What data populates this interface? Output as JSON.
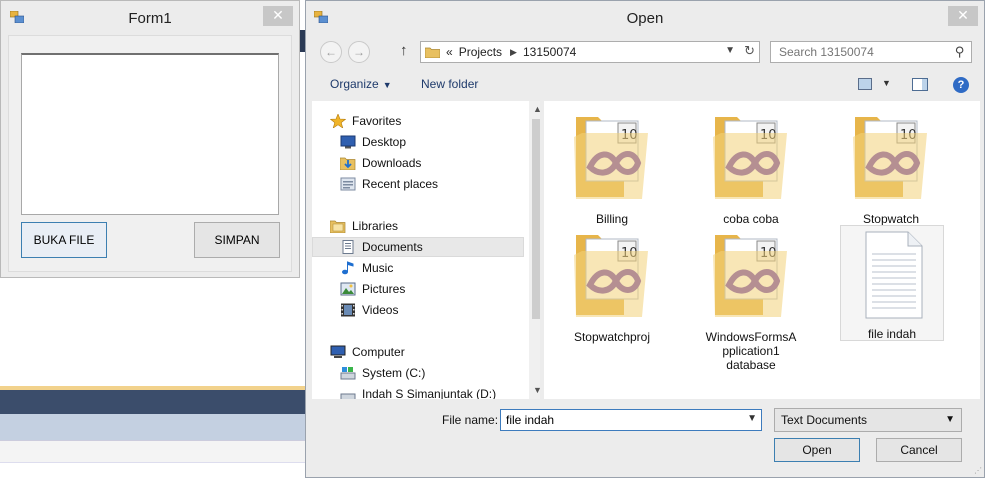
{
  "form1": {
    "title": "Form1",
    "close": "✕",
    "buka_label": "BUKA FILE",
    "simpan_label": "SIMPAN"
  },
  "dialog": {
    "title": "Open",
    "close": "✕",
    "nav": {
      "back": "←",
      "forward": "→",
      "up": "↑",
      "refresh": "↻"
    },
    "breadcrumb": [
      "«",
      "Projects",
      "13150074"
    ],
    "search_placeholder": "Search 13150074",
    "toolbar": {
      "organize": "Organize",
      "new_folder": "New folder",
      "help": "?"
    },
    "nav_tree": [
      {
        "label": "Favorites",
        "icon": "star-icon"
      },
      {
        "label": "Desktop",
        "icon": "desktop-icon"
      },
      {
        "label": "Downloads",
        "icon": "downloads-icon"
      },
      {
        "label": "Recent places",
        "icon": "recent-places-icon"
      },
      {
        "label": "Libraries",
        "icon": "libraries-icon"
      },
      {
        "label": "Documents",
        "icon": "documents-icon",
        "selected": true
      },
      {
        "label": "Music",
        "icon": "music-icon"
      },
      {
        "label": "Pictures",
        "icon": "pictures-icon"
      },
      {
        "label": "Videos",
        "icon": "videos-icon"
      },
      {
        "label": "Computer",
        "icon": "computer-icon"
      },
      {
        "label": "System (C:)",
        "icon": "drive-icon"
      },
      {
        "label": "Indah S Simanjuntak (D:)",
        "icon": "drive-icon"
      }
    ],
    "files": [
      {
        "name": "Billing",
        "type": "vs-folder"
      },
      {
        "name": "coba coba",
        "type": "vs-folder"
      },
      {
        "name": "Stopwatch",
        "type": "vs-folder"
      },
      {
        "name": "Stopwatchproj",
        "type": "vs-folder"
      },
      {
        "name": "WindowsFormsApplication1 database",
        "line1": "WindowsFormsA",
        "line2": "pplication1",
        "line3": "database",
        "type": "vs-folder"
      },
      {
        "name": "file indah",
        "type": "text-file",
        "selected": true
      }
    ],
    "file_name_label": "File name:",
    "file_name_value": "file indah",
    "file_type": "Text Documents",
    "open_label": "Open",
    "cancel_label": "Cancel"
  },
  "colors": {
    "accent_blue": "#3c7fb1",
    "ide_dark": "#3b4d6b",
    "folder_yellow": "#f3d27a",
    "vs_purple": "#6a3fb0"
  }
}
